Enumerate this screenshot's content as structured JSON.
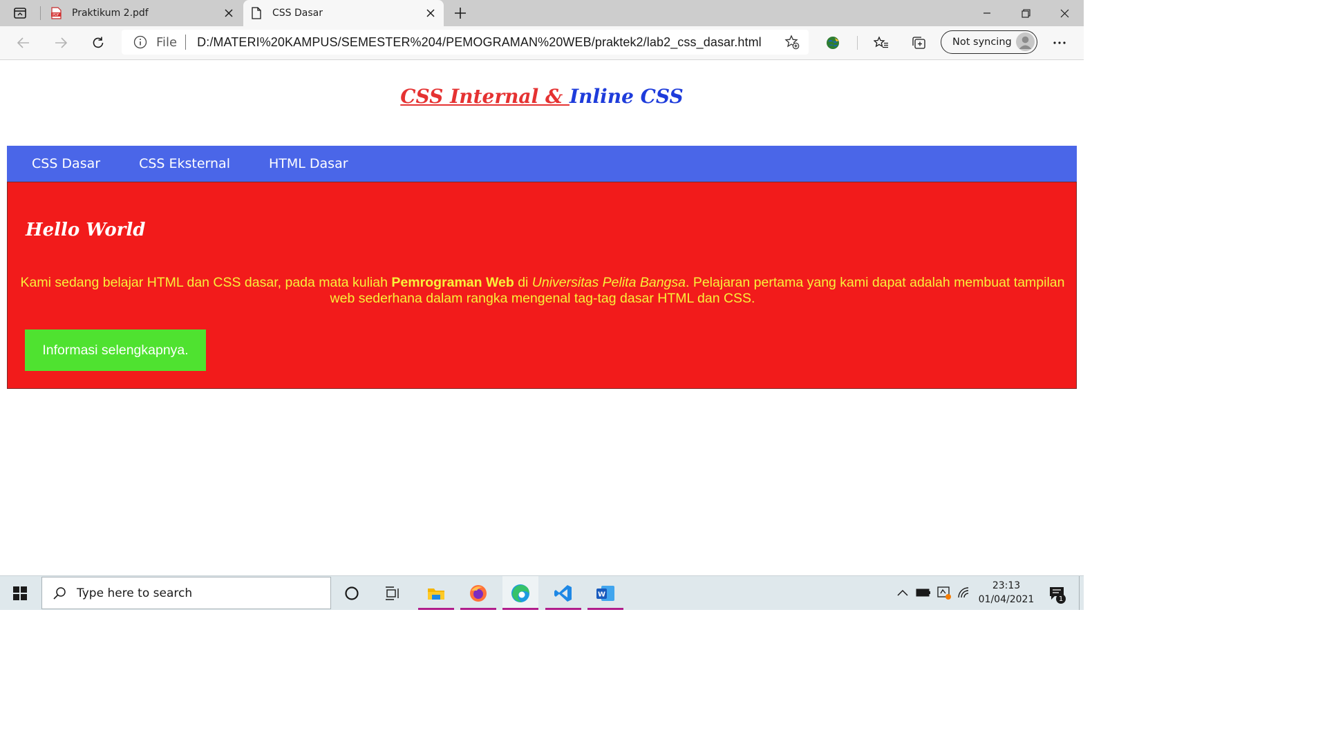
{
  "browser": {
    "tabs": [
      {
        "title": "Praktikum 2.pdf",
        "icon": "pdf-icon",
        "active": false
      },
      {
        "title": "CSS Dasar",
        "icon": "page-icon",
        "active": true
      }
    ],
    "address": {
      "scheme_label": "File",
      "url": "D:/MATERI%20KAMPUS/SEMESTER%204/PEMOGRAMAN%20WEB/praktek2/lab2_css_dasar.html"
    },
    "profile": {
      "sync_label": "Not syncing"
    }
  },
  "page": {
    "header": {
      "part1": "CSS Internal & ",
      "part2": "Inline CSS"
    },
    "nav": [
      "CSS Dasar",
      "CSS Eksternal",
      "HTML Dasar"
    ],
    "content": {
      "title": "Hello World",
      "para_1": "Kami sedang belajar HTML dan CSS dasar, pada mata kuliah ",
      "para_bold": "Pemrograman Web",
      "para_2": " di ",
      "para_italic": "Universitas Pelita Bangsa",
      "para_3": ". Pelajaran pertama yang kami dapat adalah membuat tampilan web sederhana dalam rangka mengenal tag-tag dasar HTML dan CSS.",
      "button_label": "Informasi selengkapnya."
    }
  },
  "taskbar": {
    "search_placeholder": "Type here to search",
    "time": "23:13",
    "date": "01/04/2021",
    "notification_count": "1"
  },
  "colors": {
    "header_red": "#e53232",
    "header_blue": "#1e3cdb",
    "nav_bg": "#4a66e8",
    "content_bg": "#f21b1b",
    "content_text": "#f8f13a",
    "button_bg": "#4fe230"
  }
}
